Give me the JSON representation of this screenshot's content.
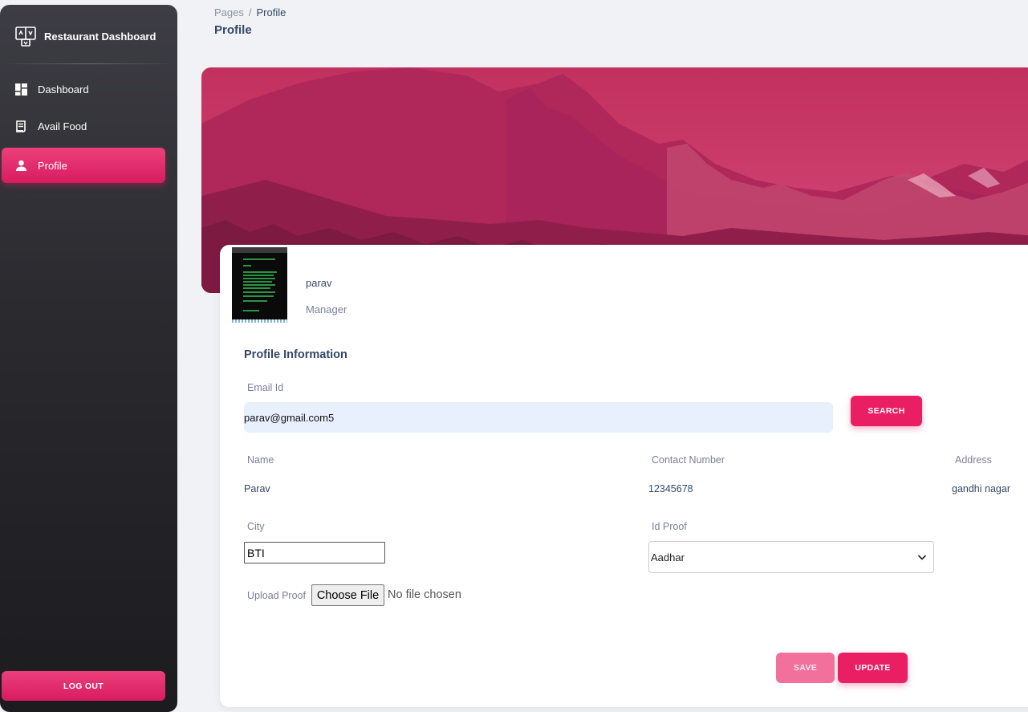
{
  "sidebar": {
    "brand": "Restaurant Dashboard",
    "items": [
      {
        "label": "Dashboard",
        "icon": "dashboard-icon"
      },
      {
        "label": "Avail Food",
        "icon": "receipt-icon"
      },
      {
        "label": "Profile",
        "icon": "person-icon",
        "active": true
      }
    ],
    "logout_label": "LOG OUT"
  },
  "header": {
    "breadcrumb_root": "Pages",
    "breadcrumb_current": "Profile",
    "title": "Profile"
  },
  "profile": {
    "name": "parav",
    "role": "Manager"
  },
  "form": {
    "section_title": "Profile Information",
    "email_label": "Email Id",
    "email_value": "parav@gmail.com5",
    "search_label": "SEARCH",
    "name_label": "Name",
    "name_value": "Parav",
    "contact_label": "Contact Number",
    "contact_value": "12345678",
    "address_label": "Address",
    "address_value": "gandhi nagar",
    "city_label": "City",
    "city_value": "BTI",
    "idproof_label": "Id Proof",
    "idproof_value": "Aadhar",
    "upload_label": "Upload Proof",
    "choose_file_label": "Choose File",
    "file_status": "No file chosen",
    "save_label": "SAVE",
    "update_label": "UPDATE"
  },
  "colors": {
    "accent": "#e91e63",
    "sidebar_dark": "#1c1c1f",
    "text_primary": "#344767",
    "text_muted": "#7b809a"
  }
}
